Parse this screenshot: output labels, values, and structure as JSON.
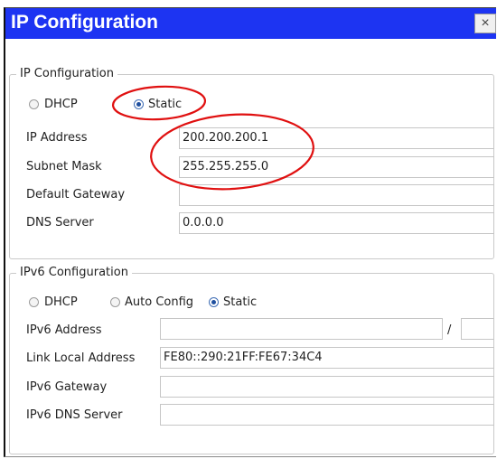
{
  "window": {
    "title": "IP Configuration",
    "close_glyph": "×"
  },
  "ipv4": {
    "legend": "IP Configuration",
    "mode": {
      "dhcp_label": "DHCP",
      "static_label": "Static",
      "selected": "Static"
    },
    "fields": {
      "ip_address": {
        "label": "IP Address",
        "value": "200.200.200.1"
      },
      "subnet_mask": {
        "label": "Subnet Mask",
        "value": "255.255.255.0"
      },
      "default_gateway": {
        "label": "Default Gateway",
        "value": ""
      },
      "dns_server": {
        "label": "DNS Server",
        "value": "0.0.0.0"
      }
    }
  },
  "ipv6": {
    "legend": "IPv6 Configuration",
    "mode": {
      "dhcp_label": "DHCP",
      "auto_label": "Auto Config",
      "static_label": "Static",
      "selected": "Static"
    },
    "fields": {
      "address": {
        "label": "IPv6 Address",
        "value": "",
        "separator": "/",
        "prefix": ""
      },
      "link_local": {
        "label": "Link Local Address",
        "value": "FE80::290:21FF:FE67:34C4"
      },
      "gateway": {
        "label": "IPv6 Gateway",
        "value": ""
      },
      "dns_server": {
        "label": "IPv6 DNS Server",
        "value": ""
      }
    }
  },
  "colors": {
    "titlebar": "#1d34f2",
    "title_text": "#ffffff",
    "annotation_circles": "#e01010"
  }
}
